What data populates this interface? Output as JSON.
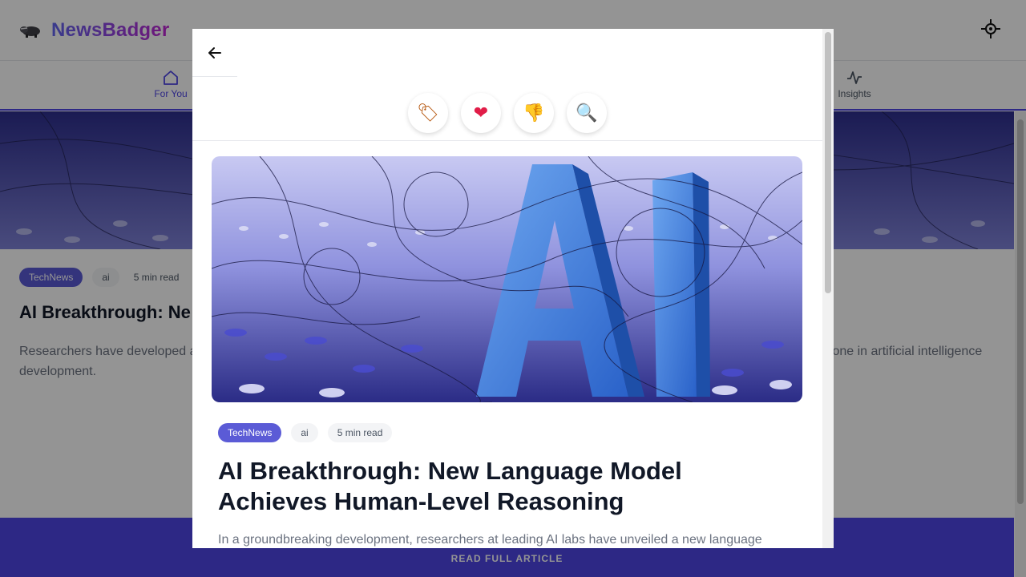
{
  "app": {
    "brand": "NewsBadger",
    "accent": "#4f46e5",
    "brand_gradient": [
      "#6366f1",
      "#c026d3"
    ]
  },
  "nav": {
    "items": [
      {
        "label": "For You",
        "icon": "home-icon",
        "active": true
      },
      {
        "label": "Insights",
        "icon": "activity-icon",
        "active": false
      }
    ]
  },
  "feed": {
    "card": {
      "source": "TechNews",
      "tag": "ai",
      "read_time": "5 min read",
      "title_fragment": "AI Breakthrough: Ne",
      "desc_left": "Researchers have developed a",
      "desc_right": "tone in artificial intelligence",
      "desc_line2": "development."
    },
    "cta": "READ FULL ARTICLE"
  },
  "modal": {
    "actions": [
      {
        "name": "tag-action-button",
        "icon": "tag-icon",
        "glyph": "🏷"
      },
      {
        "name": "like-action-button",
        "icon": "heart-icon",
        "glyph": "❤"
      },
      {
        "name": "dislike-action-button",
        "icon": "thumbs-down-icon",
        "glyph": "👎"
      },
      {
        "name": "search-action-button",
        "icon": "magnifier-icon",
        "glyph": "🔍"
      }
    ],
    "article": {
      "source": "TechNews",
      "tag": "ai",
      "read_time": "5 min read",
      "title": "AI Breakthrough: New Language Model Achieves Human-Level Reasoning",
      "body": "In a groundbreaking development, researchers at leading AI labs have unveiled a new language"
    }
  }
}
